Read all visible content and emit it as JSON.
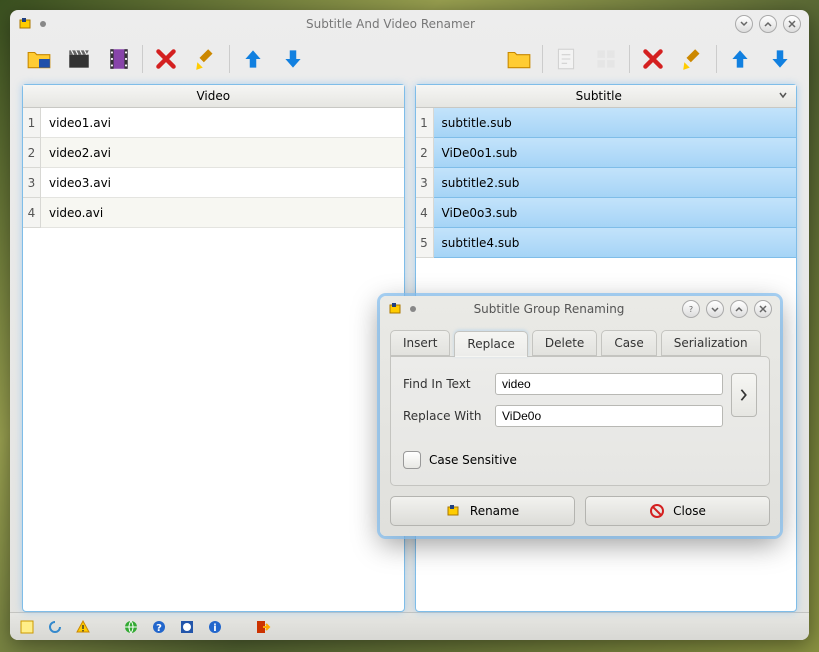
{
  "main": {
    "title": "Subtitle And Video Renamer",
    "video_header": "Video",
    "subtitle_header": "Subtitle",
    "videos": [
      "video1.avi",
      "video2.avi",
      "video3.avi",
      "video.avi"
    ],
    "subtitles": [
      "subtitle.sub",
      "ViDe0o1.sub",
      "subtitle2.sub",
      "ViDe0o3.sub",
      "subtitle4.sub"
    ]
  },
  "dialog": {
    "title": "Subtitle Group Renaming",
    "tabs": {
      "insert": "Insert",
      "replace": "Replace",
      "delete": "Delete",
      "case": "Case",
      "serialization": "Serialization"
    },
    "find_label": "Find In Text",
    "find_value": "video",
    "replace_label": "Replace With",
    "replace_value": "ViDe0o",
    "case_sensitive": "Case Sensitive",
    "rename": "Rename",
    "close": "Close"
  }
}
